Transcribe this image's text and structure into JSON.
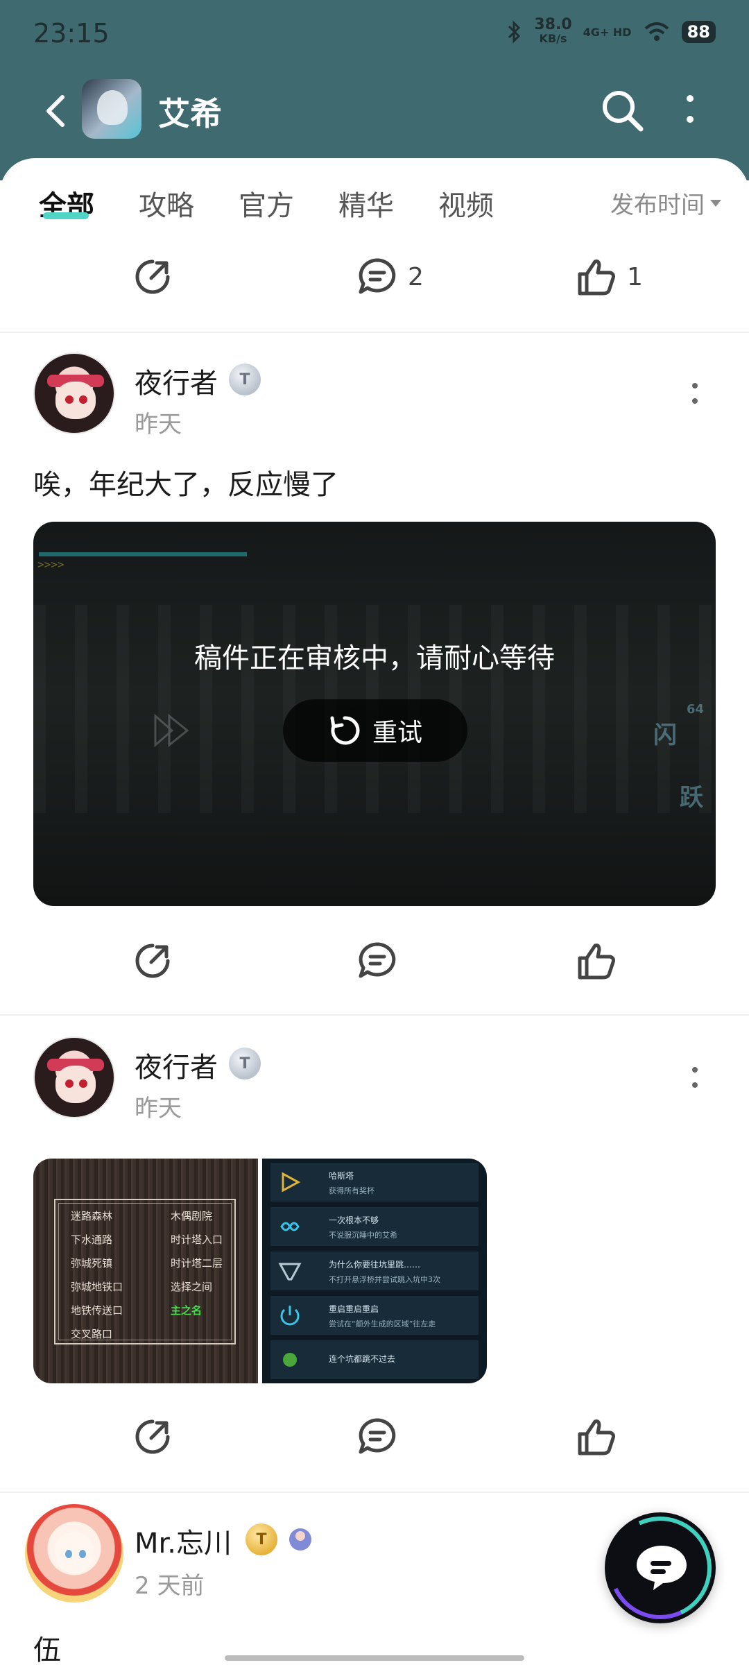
{
  "status_bar": {
    "time": "23:15",
    "net_speed_value": "38.0",
    "net_speed_unit": "KB/s",
    "network": "4G+ HD",
    "battery": "88"
  },
  "header": {
    "game_title": "艾希"
  },
  "tabs": [
    {
      "label": "全部",
      "active": true
    },
    {
      "label": "攻略",
      "active": false
    },
    {
      "label": "官方",
      "active": false
    },
    {
      "label": "精华",
      "active": false
    },
    {
      "label": "视频",
      "active": false
    }
  ],
  "sort": {
    "label": "发布时间"
  },
  "top_actions": {
    "comment_count": "2",
    "like_count": "1"
  },
  "posts": [
    {
      "username": "夜行者",
      "badge": "T",
      "time": "昨天",
      "text": "唉，年纪大了，反应慢了",
      "video": {
        "review_message": "稿件正在审核中，请耐心等待",
        "retry_label": "重试",
        "hud_labels": [
          "闪",
          "跃"
        ],
        "hud_number": "64"
      }
    },
    {
      "username": "夜行者",
      "badge": "T",
      "time": "昨天",
      "images": {
        "menu_items": [
          "迷路森林",
          "木偶剧院",
          "下水通路",
          "时计塔入口",
          "弥城死镇",
          "时计塔二层",
          "弥城地铁口",
          "选择之间",
          "地铁传送口",
          "主之名",
          "交叉路口"
        ],
        "achievements": [
          {
            "title": "哈斯塔",
            "desc": "获得所有奖杯"
          },
          {
            "title": "一次根本不够",
            "desc": "不说服沉睡中的艾希"
          },
          {
            "title": "为什么你要往坑里跳……",
            "desc": "不打开悬浮桥并尝试跳入坑中3次"
          },
          {
            "title": "重启重启重启",
            "desc": "尝试在“额外生成的区域”往左走"
          },
          {
            "title": "连个坑都跳不过去",
            "desc": ""
          }
        ]
      }
    },
    {
      "username": "Mr.忘川",
      "badge": "T",
      "time": "2 天前",
      "text": "伍"
    }
  ],
  "icons": {
    "share": "share-icon",
    "comment": "comment-icon",
    "like": "thumbs-up-icon",
    "retry": "refresh-icon",
    "chat": "chat-bubble-icon"
  },
  "colors": {
    "header_bg": "#3f6a70",
    "tab_underline": "#4fd4c6",
    "highlight_green": "#3fe04a"
  }
}
